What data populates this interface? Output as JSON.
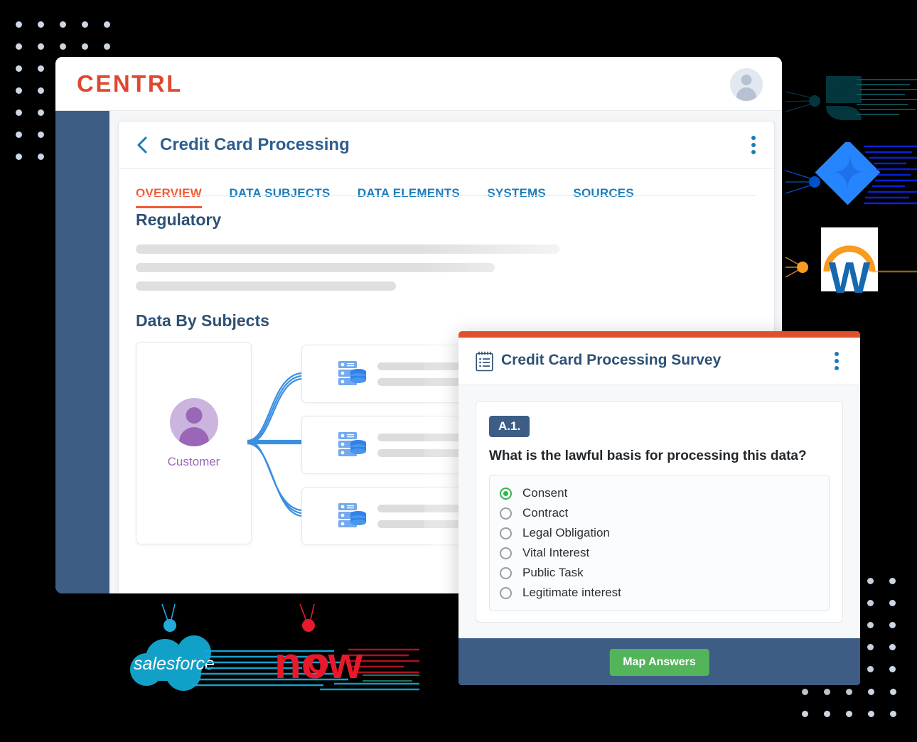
{
  "app": {
    "brand": "CENTRL",
    "avatar_icon": "user-avatar-icon"
  },
  "page": {
    "title": "Credit Card Processing",
    "back_icon": "chevron-left-icon",
    "kebab_icon": "more-vertical-icon"
  },
  "tabs": [
    {
      "label": "OVERVIEW",
      "active": true
    },
    {
      "label": "DATA SUBJECTS",
      "active": false
    },
    {
      "label": "DATA ELEMENTS",
      "active": false
    },
    {
      "label": "SYSTEMS",
      "active": false
    },
    {
      "label": "SOURCES",
      "active": false
    }
  ],
  "sections": {
    "regulatory": {
      "heading": "Regulatory",
      "skeleton_widths": [
        596,
        505,
        366
      ]
    },
    "data_by_subjects": {
      "heading": "Data By Subjects",
      "subject": {
        "label": "Customer",
        "avatar_icon": "person-avatar-icon"
      },
      "system_cards": [
        {
          "icon": "database-server-icon"
        },
        {
          "icon": "database-server-icon"
        },
        {
          "icon": "database-server-icon"
        }
      ]
    }
  },
  "survey": {
    "icon": "notepad-icon",
    "title": "Credit Card Processing Survey",
    "kebab_icon": "more-vertical-icon",
    "question": {
      "badge": "A.1.",
      "text": "What is the lawful basis for processing this data?",
      "options": [
        {
          "label": "Consent",
          "selected": true
        },
        {
          "label": "Contract",
          "selected": false
        },
        {
          "label": "Legal Obligation",
          "selected": false
        },
        {
          "label": "Vital Interest",
          "selected": false
        },
        {
          "label": "Public Task",
          "selected": false
        },
        {
          "label": "Legitimate interest",
          "selected": false
        }
      ]
    },
    "footer": {
      "button_label": "Map Answers"
    }
  },
  "integrations": [
    {
      "name": "Zendesk",
      "icon": "zendesk-logo",
      "color": "#03363d"
    },
    {
      "name": "Jira",
      "icon": "jira-logo",
      "color": "#2684ff"
    },
    {
      "name": "Workday",
      "icon": "workday-logo",
      "color": "#f79b22"
    },
    {
      "name": "Salesforce",
      "icon": "salesforce-logo",
      "color": "#00a1e0"
    },
    {
      "name": "ServiceNow",
      "icon": "servicenow-now-logo",
      "color": "#ee0000"
    }
  ],
  "colors": {
    "brand_red": "#de4830",
    "accent_orange": "#f05a37",
    "link_blue": "#1a7bb9",
    "sidebar_blue": "#3d5d85",
    "heading_blue": "#2d5174",
    "success_green": "#54b45a",
    "radio_green": "#35b44b",
    "subject_purple": "#9a67b8",
    "connector_blue": "#3b8fe0",
    "dot_grid": "#ccd7e2"
  }
}
